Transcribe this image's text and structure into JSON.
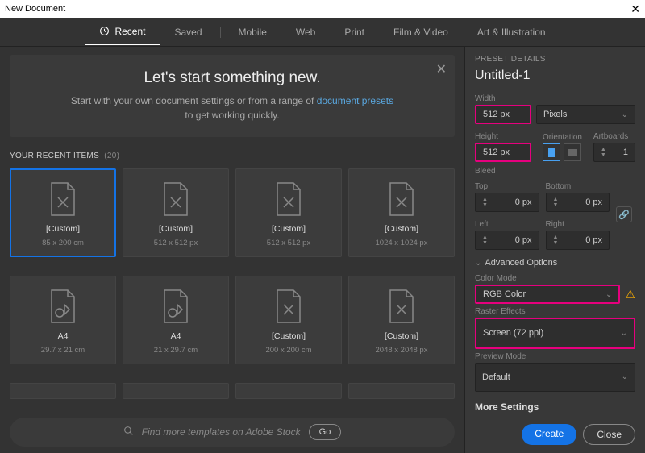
{
  "window": {
    "title": "New Document"
  },
  "tabs": {
    "recent": "Recent",
    "saved": "Saved",
    "mobile": "Mobile",
    "web": "Web",
    "print": "Print",
    "film": "Film & Video",
    "art": "Art & Illustration"
  },
  "intro": {
    "heading": "Let's start something new.",
    "line1a": "Start with your own document settings or from a range of ",
    "line1b": "document presets",
    "line2": "to get working quickly."
  },
  "recent": {
    "header": "YOUR RECENT ITEMS",
    "count": "(20)"
  },
  "cards": [
    {
      "label": "[Custom]",
      "sub": "85 x 200 cm"
    },
    {
      "label": "[Custom]",
      "sub": "512 x 512 px"
    },
    {
      "label": "[Custom]",
      "sub": "512 x 512 px"
    },
    {
      "label": "[Custom]",
      "sub": "1024 x 1024 px"
    },
    {
      "label": "A4",
      "sub": "29.7 x 21 cm"
    },
    {
      "label": "A4",
      "sub": "21 x 29.7 cm"
    },
    {
      "label": "[Custom]",
      "sub": "200 x 200 cm"
    },
    {
      "label": "[Custom]",
      "sub": "2048 x 2048 px"
    }
  ],
  "stock": {
    "placeholder": "Find more templates on Adobe Stock",
    "go": "Go"
  },
  "panel": {
    "header": "PRESET DETAILS",
    "docName": "Untitled-1",
    "widthLabel": "Width",
    "width": "512 px",
    "units": "Pixels",
    "heightLabel": "Height",
    "height": "512 px",
    "orientLabel": "Orientation",
    "artboardsLabel": "Artboards",
    "artboards": "1",
    "bleedLabel": "Bleed",
    "top": "Top",
    "bottom": "Bottom",
    "left": "Left",
    "right": "Right",
    "bleedVal": "0 px",
    "adv": "Advanced Options",
    "colorModeLabel": "Color Mode",
    "colorMode": "RGB Color",
    "rasterLabel": "Raster Effects",
    "raster": "Screen (72 ppi)",
    "previewLabel": "Preview Mode",
    "preview": "Default",
    "more": "More Settings",
    "create": "Create",
    "close": "Close"
  }
}
